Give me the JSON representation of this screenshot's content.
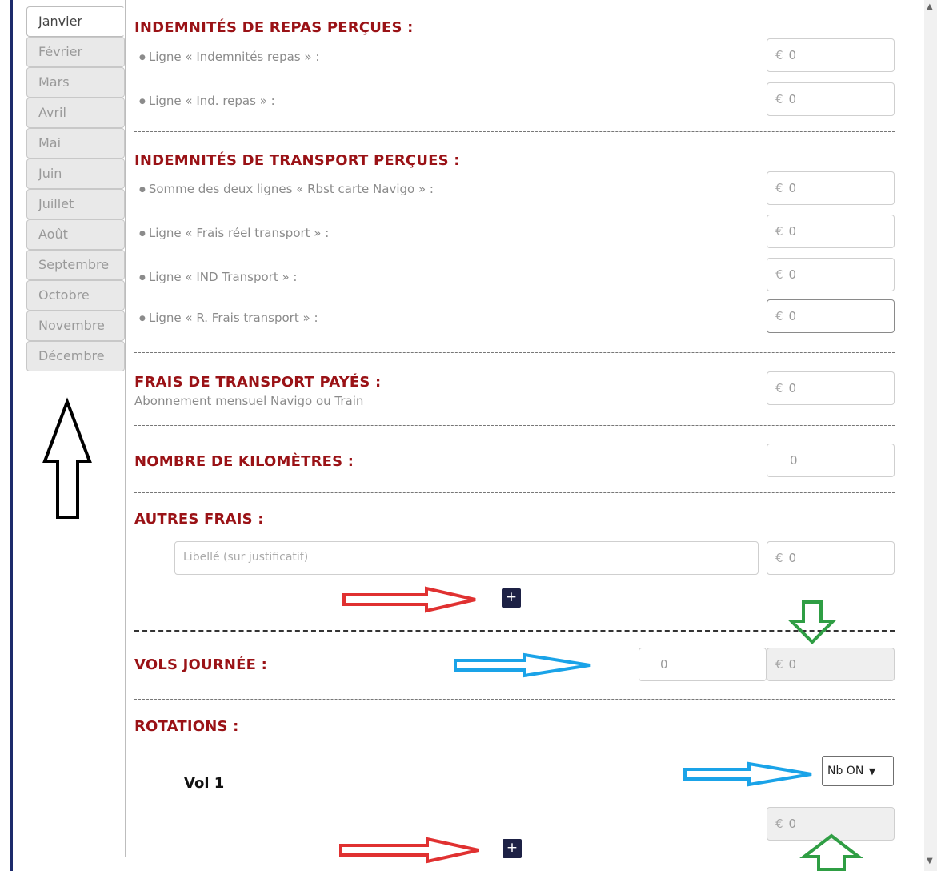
{
  "months": [
    "Janvier",
    "Février",
    "Mars",
    "Avril",
    "Mai",
    "Juin",
    "Juillet",
    "Août",
    "Septembre",
    "Octobre",
    "Novembre",
    "Décembre"
  ],
  "sections": {
    "repas": {
      "title": "INDEMNITÉS DE REPAS PERÇUES :",
      "rows": [
        {
          "label": "Ligne « Indemnités repas » :",
          "value": "0"
        },
        {
          "label": "Ligne « Ind. repas » :",
          "value": "0"
        }
      ]
    },
    "transport": {
      "title": "INDEMNITÉS DE TRANSPORT PERÇUES :",
      "rows": [
        {
          "label": "Somme des deux lignes « Rbst carte Navigo » :",
          "value": "0"
        },
        {
          "label": "Ligne « Frais réel transport » :",
          "value": "0"
        },
        {
          "label": "Ligne « IND Transport » :",
          "value": "0"
        },
        {
          "label": "Ligne « R. Frais transport » :",
          "value": "0"
        }
      ]
    },
    "frais_transport": {
      "title": "FRAIS DE TRANSPORT PAYÉS :",
      "subtitle": "Abonnement mensuel Navigo ou Train",
      "value": "0"
    },
    "kilometres": {
      "title": "NOMBRE DE KILOMÈTRES :",
      "value": "0"
    },
    "autres": {
      "title": "AUTRES FRAIS :",
      "placeholder": "Libellé (sur justificatif)",
      "value": "0",
      "add_label": "+"
    },
    "vols": {
      "title": "VOLS JOURNÉE :",
      "count": "0",
      "value": "0"
    },
    "rotations": {
      "title": "ROTATIONS :",
      "vol_label": "Vol 1",
      "select_value": "Nb ON",
      "value": "0",
      "add_label": "+"
    }
  },
  "currency_symbol": "€",
  "icons": {
    "chevron": "chevron-down-icon",
    "scroll_up": "scroll-up-icon",
    "scroll_down": "scroll-down-icon"
  },
  "annotation_colors": {
    "black": "#000000",
    "red": "#e03131",
    "blue": "#1aa3e8",
    "green": "#2f9e44"
  }
}
